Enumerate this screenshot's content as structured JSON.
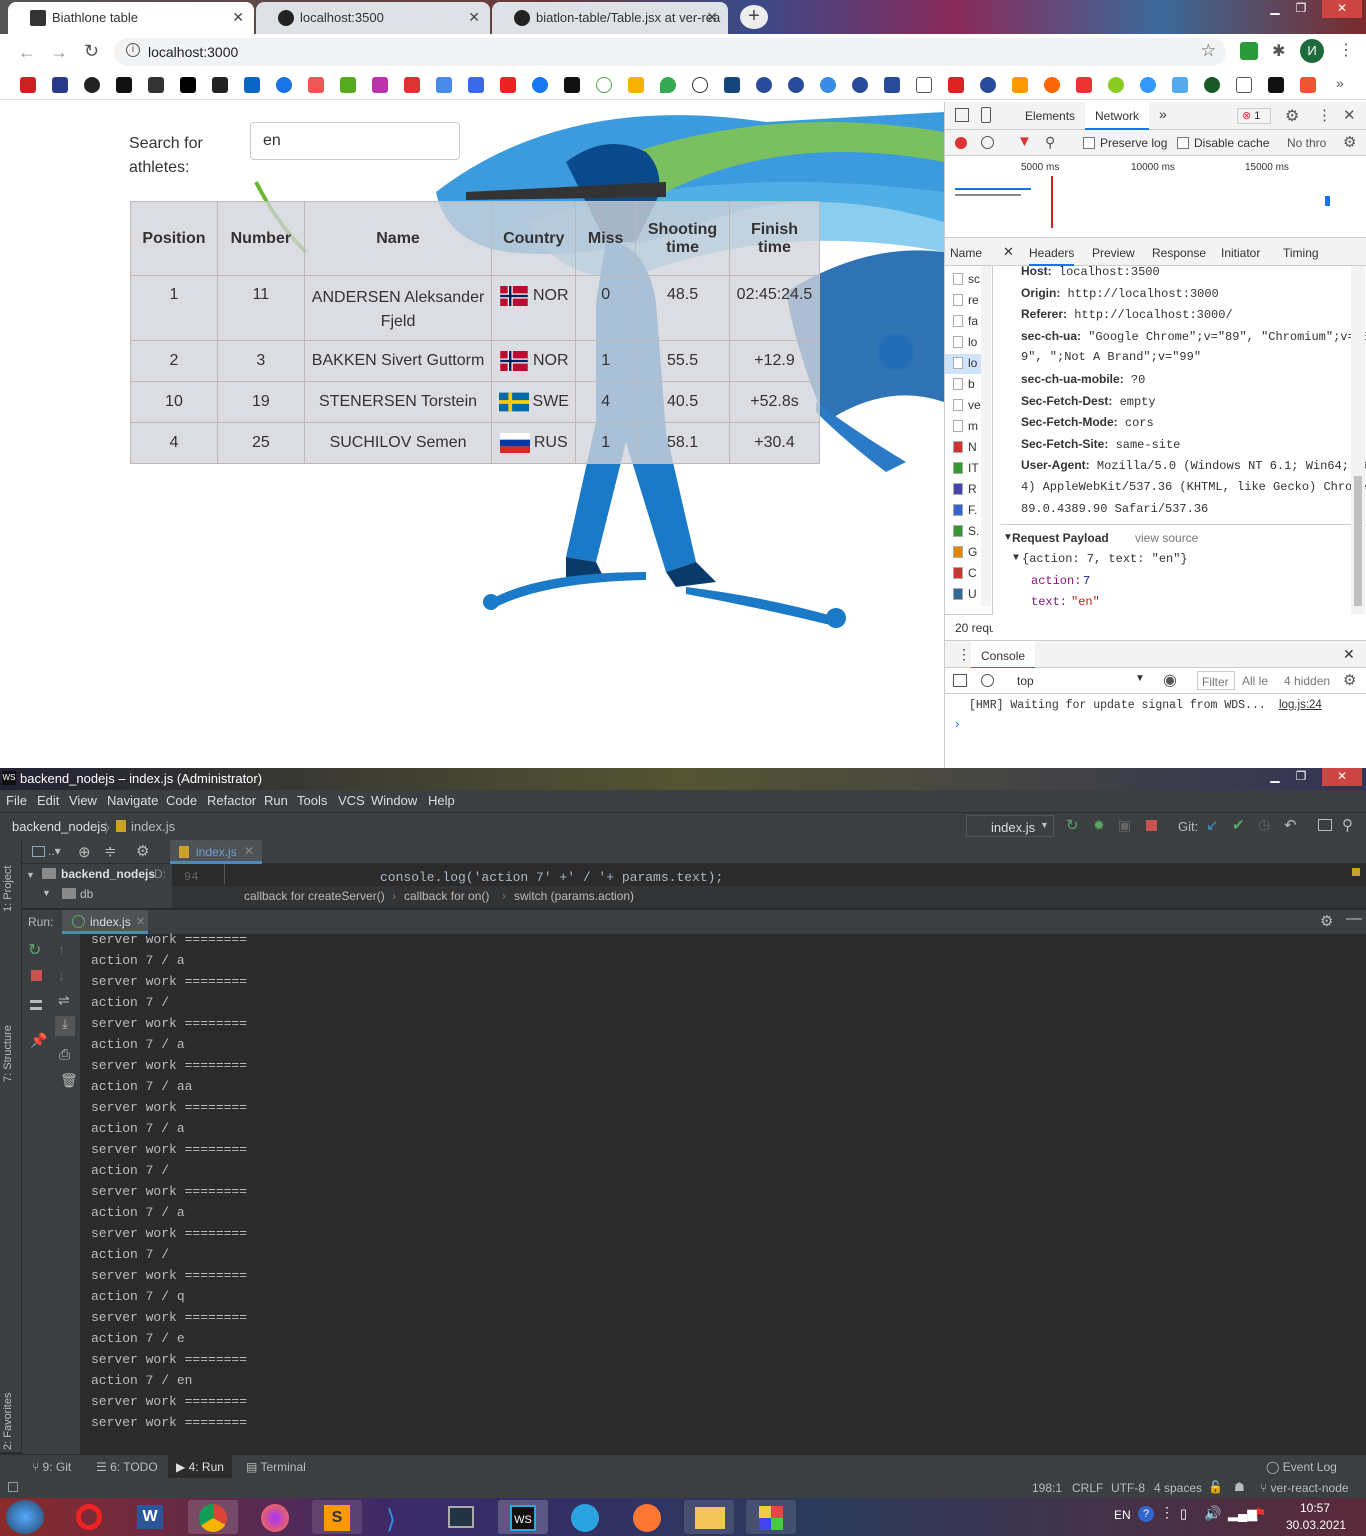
{
  "browser": {
    "tabs": [
      {
        "title": "Biathlone table",
        "active": true
      },
      {
        "title": "localhost:3500",
        "active": false
      },
      {
        "title": "biatlon-table/Table.jsx at ver-rea",
        "active": false
      }
    ],
    "url": "localhost:3000",
    "profile_initial": "И"
  },
  "page": {
    "search_label": "Search for athletes:",
    "search_value": "en",
    "table": {
      "headers": [
        "Position",
        "Number",
        "Name",
        "Country",
        "Miss",
        "Shooting time",
        "Finish time"
      ],
      "rows": [
        {
          "position": "1",
          "number": "11",
          "name": "ANDERSEN Aleksander Fjeld",
          "country": "NOR",
          "flag": "norway",
          "miss": "0",
          "shooting": "48.5",
          "finish": "02:45:24.5"
        },
        {
          "position": "2",
          "number": "3",
          "name": "BAKKEN Sivert Guttorm",
          "country": "NOR",
          "flag": "norway",
          "miss": "1",
          "shooting": "55.5",
          "finish": "+12.9"
        },
        {
          "position": "10",
          "number": "19",
          "name": "STENERSEN Torstein",
          "country": "SWE",
          "flag": "sweden",
          "miss": "4",
          "shooting": "40.5",
          "finish": "+52.8s"
        },
        {
          "position": "4",
          "number": "25",
          "name": "SUCHILOV Semen",
          "country": "RUS",
          "flag": "russia",
          "miss": "1",
          "shooting": "58.1",
          "finish": "+30.4"
        }
      ]
    }
  },
  "devtools": {
    "tabs": [
      "Elements",
      "Network"
    ],
    "active_tab": "Network",
    "error_count": "1",
    "toolbar": {
      "preserve_log": "Preserve log",
      "disable_cache": "Disable cache",
      "throttle": "No thro"
    },
    "timeline_labels": [
      "5000 ms",
      "10000 ms",
      "15000 ms"
    ],
    "name_col": "Name",
    "detail_tabs": [
      "Headers",
      "Preview",
      "Response",
      "Initiator",
      "Timing"
    ],
    "request_names": [
      "sc",
      "re",
      "fa",
      "lo",
      "lo",
      "b",
      "ve",
      "m",
      "N",
      "IT",
      "R",
      "F.",
      "S.",
      "G",
      "C",
      "U"
    ],
    "requests_count": "20 requ",
    "headers": [
      {
        "k": "Host:",
        "v": "localhost:3500"
      },
      {
        "k": "Origin:",
        "v": "http://localhost:3000"
      },
      {
        "k": "Referer:",
        "v": "http://localhost:3000/"
      },
      {
        "k": "sec-ch-ua:",
        "v": "\"Google Chrome\";v=\"89\", \"Chromium\";v=\"8"
      },
      {
        "k": "",
        "v": "9\", \";Not A Brand\";v=\"99\""
      },
      {
        "k": "sec-ch-ua-mobile:",
        "v": "?0"
      },
      {
        "k": "Sec-Fetch-Dest:",
        "v": "empty"
      },
      {
        "k": "Sec-Fetch-Mode:",
        "v": "cors"
      },
      {
        "k": "Sec-Fetch-Site:",
        "v": "same-site"
      },
      {
        "k": "User-Agent:",
        "v": "Mozilla/5.0 (Windows NT 6.1; Win64; x6"
      },
      {
        "k": "",
        "v": "4) AppleWebKit/537.36 (KHTML, like Gecko) Chrome/"
      },
      {
        "k": "",
        "v": "89.0.4389.90 Safari/537.36"
      }
    ],
    "payload_title": "Request Payload",
    "view_source": "view source",
    "payload_obj": "{action: 7, text: \"en\"}",
    "payload_action_key": "action:",
    "payload_action_val": "7",
    "payload_text_key": "text:",
    "payload_text_val": "\"en\"",
    "console_tab": "Console",
    "console_context": "top",
    "console_filter": "Filter",
    "console_levels": "All le",
    "console_hidden": "4 hidden",
    "console_msg": "[HMR] Waiting for update signal from WDS...",
    "console_src": "log.js:24"
  },
  "ide": {
    "title": "backend_nodejs – index.js (Administrator)",
    "menu": [
      "File",
      "Edit",
      "View",
      "Navigate",
      "Code",
      "Refactor",
      "Run",
      "Tools",
      "VCS",
      "Window",
      "Help"
    ],
    "breadcrumb_project": "backend_nodejs",
    "breadcrumb_file": "index.js",
    "run_config": "index.js",
    "git_label": "Git:",
    "editor_tab": "index.js",
    "project_root": "backend_nodejs",
    "project_root_suffix": "D:",
    "project_db": "db",
    "line_no": "94",
    "code_line": "console.log('action 7' +' / '+ params.text);",
    "crumbs": [
      "callback for createServer()",
      "callback for on()",
      "switch (params.action)"
    ],
    "run_label": "Run:",
    "run_tab": "index.js",
    "side_project": "1: Project",
    "side_structure": "7: Structure",
    "side_favorites": "2: Favorites",
    "console_lines": [
      "server work ========",
      "action 7 / a",
      "server work ========",
      "action 7 /",
      "server work ========",
      "action 7 / a",
      "server work ========",
      "action 7 / aa",
      "server work ========",
      "action 7 / a",
      "server work ========",
      "action 7 /",
      "server work ========",
      "action 7 / a",
      "server work ========",
      "action 7 /",
      "server work ========",
      "action 7 / q",
      "server work ========",
      "action 7 / e",
      "server work ========",
      "action 7 / en",
      "server work ========",
      "server work ========"
    ],
    "bottom_tabs": [
      "9: Git",
      "6: TODO",
      "4: Run",
      "Terminal"
    ],
    "event_log": "Event Log",
    "status": {
      "pos": "198:1",
      "eol": "CRLF",
      "enc": "UTF-8",
      "indent": "4 spaces",
      "branch": "ver-react-node"
    }
  },
  "taskbar": {
    "lang": "EN",
    "time": "10:57",
    "date": "30.03.2021"
  },
  "colors": {
    "accent": "#1a73e8",
    "ide_bg": "#2b2b2b",
    "ide_panel": "#3c3f41"
  }
}
